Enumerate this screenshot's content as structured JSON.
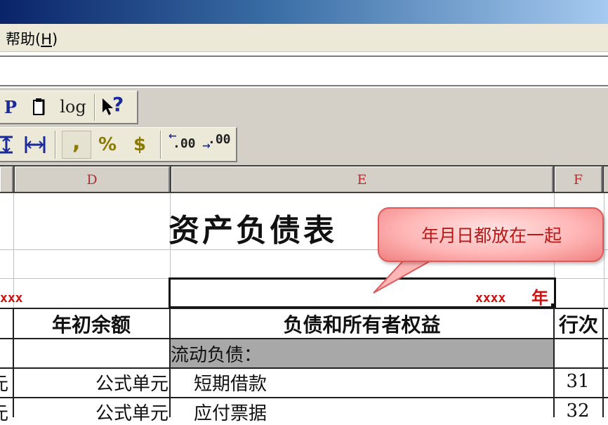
{
  "menu": {
    "help_label": "帮助",
    "help_hotkey": "H"
  },
  "toolbar1": {
    "p_label": "P",
    "log_label": "log",
    "help_pointer": "?"
  },
  "toolbar2": {
    "comma": ",",
    "percent": "%",
    "dollar": "$",
    "inc_decimal": ".00",
    "dec_decimal": ".00"
  },
  "columns": {
    "d": "D",
    "e": "E",
    "f": "F"
  },
  "sheet": {
    "title": "资产负债表",
    "left_partial_red": "xxx",
    "date_red": "xxxx",
    "date_suffix": "年",
    "headers": {
      "opening_balance": "年初余额",
      "liabilities_equity": "负债和所有者权益",
      "line_no": "行次"
    },
    "section_current_liabilities": "流动负债：",
    "rows": [
      {
        "left_partial": "元",
        "formula": "公式单元",
        "item": "短期借款",
        "line": "31"
      },
      {
        "left_partial": "元",
        "formula": "公式单元",
        "item": "应付票据",
        "line": "32"
      }
    ]
  },
  "callout": {
    "text": "年月日都放在一起"
  },
  "colors": {
    "title_bar_start": "#0a246a",
    "toolbar_bg": "#ece9d8",
    "section_fill": "#a8a8a8",
    "red_text": "#cc1111",
    "callout_fill": "#ffb6b6"
  }
}
